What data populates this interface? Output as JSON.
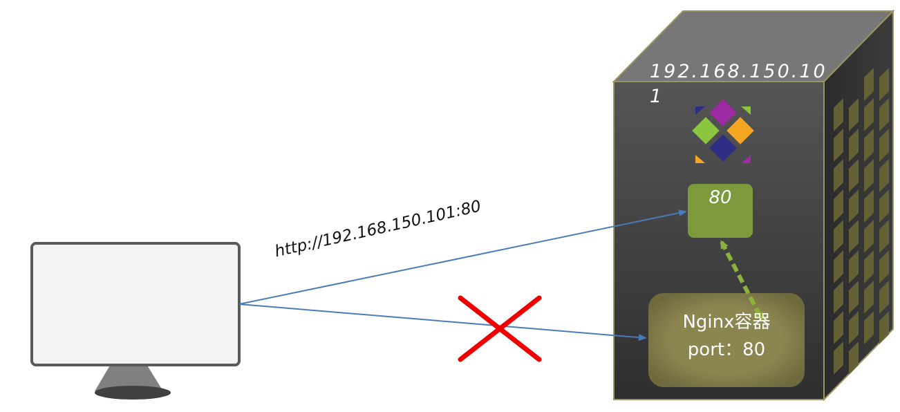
{
  "server": {
    "ip": "192.168.150.101",
    "host_port": "80"
  },
  "container": {
    "name": "Nginx容器",
    "port_line": "port：80"
  },
  "request": {
    "url": "http://192.168.150.101:80"
  },
  "colors": {
    "server_front": "#3a3a3a",
    "server_top": "#727272",
    "server_side": "#2c2c2c",
    "server_edge": "#9a9362",
    "port_box": "#7a9a3c",
    "container_box": "#8b8550",
    "arrow": "#4a7ab8",
    "dashed_link": "#8db23c",
    "cross": "#ee0000",
    "monitor_screen": "#f2f2f2",
    "monitor_frame": "#595959"
  },
  "icons": {
    "server": "server-cabinet-icon",
    "monitor": "monitor-icon",
    "logo": "diamond-logo-icon",
    "blocked": "red-cross-icon"
  }
}
